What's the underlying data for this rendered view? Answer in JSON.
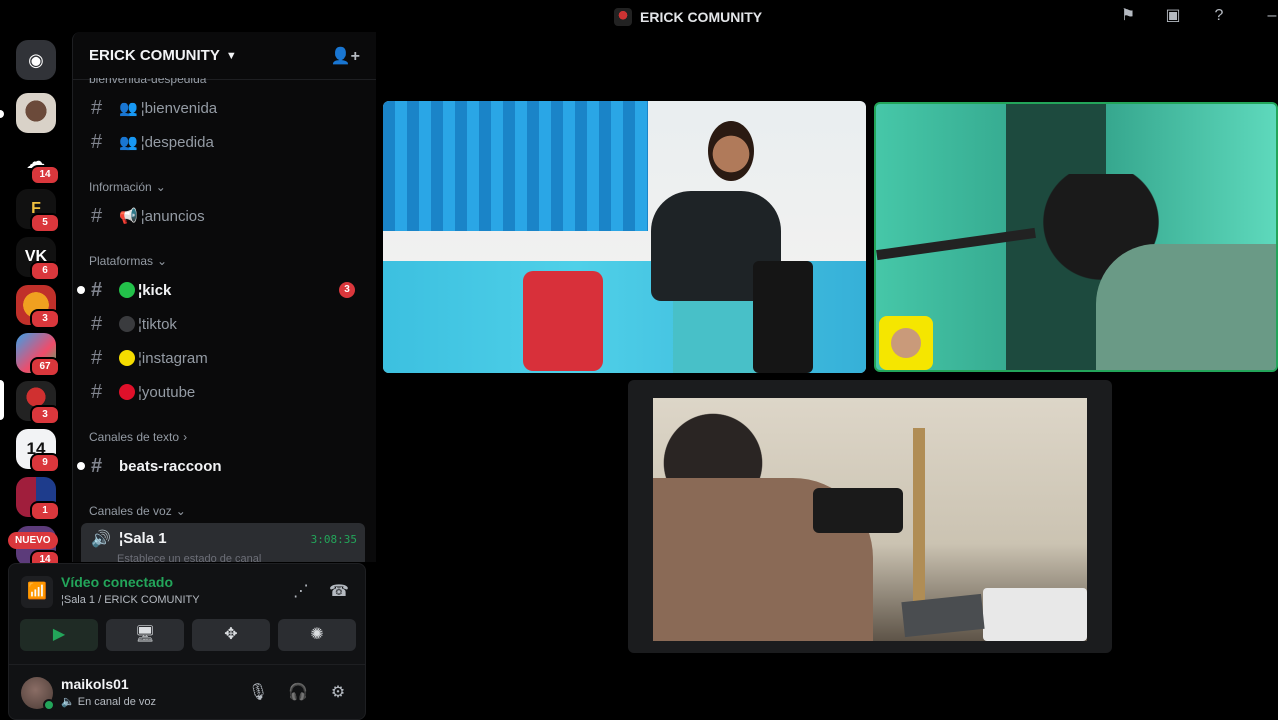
{
  "window": {
    "title": "ERICK COMUNITY"
  },
  "guild": {
    "name": "ERICK COMUNITY",
    "cut_category": "bienvenida-despedida"
  },
  "servers": [
    {
      "label": "",
      "badge": ""
    },
    {
      "label": "",
      "badge": "14"
    },
    {
      "label": "F",
      "badge": "5"
    },
    {
      "label": "VK",
      "badge": "6"
    },
    {
      "label": "",
      "badge": "3"
    },
    {
      "label": "",
      "badge": "67"
    },
    {
      "label": "",
      "badge": "3"
    },
    {
      "label": "14",
      "badge": "9"
    },
    {
      "label": "",
      "badge": "1"
    },
    {
      "label": "",
      "badge": "14"
    }
  ],
  "nuevo": "NUEVO",
  "channels": {
    "bienvenida": "¦bienvenida",
    "despedida": "¦despedida",
    "cat_info": "Información",
    "anuncios": "¦anuncios",
    "cat_plat": "Plataformas",
    "kick": "¦kick",
    "kick_mentions": "3",
    "tiktok": "¦tiktok",
    "instagram": "¦instagram",
    "youtube": "¦youtube",
    "cat_text": "Canales de texto",
    "beats": "beats-raccoon",
    "cat_voice": "Canales de voz",
    "sala": "¦Sala 1",
    "sala_time": "3:08:35",
    "sala_status": "Establece un estado de canal"
  },
  "voice_panel": {
    "title": "Vídeo conectado",
    "subtitle": "¦Sala 1 / ERICK COMUNITY"
  },
  "user": {
    "name": "maikols01",
    "status": "En canal de voz"
  }
}
